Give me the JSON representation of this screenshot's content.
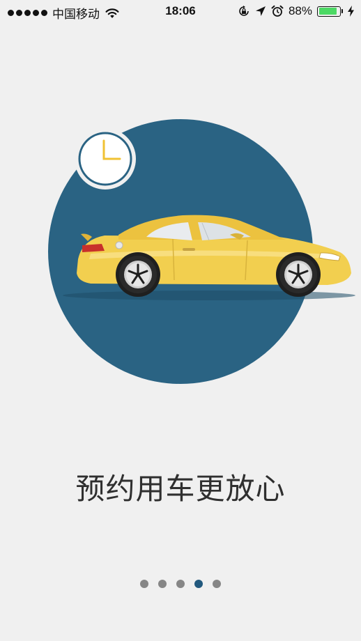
{
  "status_bar": {
    "carrier": "中国移动",
    "time": "18:06",
    "battery_percent": "88%",
    "battery_level": 0.88,
    "icons": [
      "signal-dots-icon",
      "wifi-icon",
      "rotation-lock-icon",
      "location-arrow-icon",
      "alarm-clock-icon",
      "battery-icon",
      "charging-bolt-icon"
    ]
  },
  "illustration": {
    "subject": "yellow-sports-car",
    "badge_icon": "clock-icon",
    "colors": {
      "circle": "#2a6383",
      "car_body": "#f2cf4f",
      "clock_hand": "#f0c233"
    }
  },
  "onboarding": {
    "title": "预约用车更放心"
  },
  "pager": {
    "total": 5,
    "current": 4,
    "active_color": "#22597e",
    "inactive_color": "#868686"
  }
}
